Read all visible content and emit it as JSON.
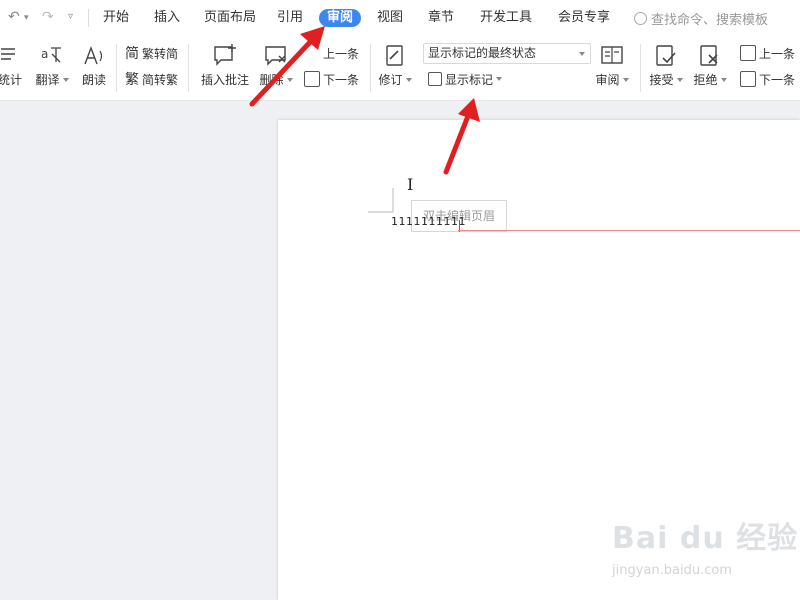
{
  "quick_access": {
    "undo_icon": "undo-icon",
    "redo_icon": "redo-icon",
    "more_icon": "customize-icon"
  },
  "tabs": [
    {
      "label": "开始"
    },
    {
      "label": "插入"
    },
    {
      "label": "页面布局"
    },
    {
      "label": "引用"
    },
    {
      "label": "审阅",
      "active": true
    },
    {
      "label": "视图"
    },
    {
      "label": "章节"
    },
    {
      "label": "开发工具"
    },
    {
      "label": "会员专享"
    }
  ],
  "search": {
    "placeholder": "查找命令、搜索模板"
  },
  "ribbon": {
    "word_count": "统计",
    "translate": "翻译",
    "read_aloud": "朗读",
    "trad_to_simp": "繁转简",
    "simp_to_trad": "简转繁",
    "insert_comment": "插入批注",
    "delete_comment": "删除",
    "prev_comment": "上一条",
    "next_comment": "下一条",
    "track_changes": "修订",
    "markup_state": "显示标记的最终状态",
    "show_markup": "显示标记",
    "review_pane": "审阅",
    "accept": "接受",
    "reject": "拒绝",
    "prev_change": "上一条",
    "next_change": "下一条"
  },
  "document": {
    "header_tooltip": "双击编辑页眉",
    "body_text": "1111111111"
  },
  "watermark": {
    "brand": "Bai du 经验",
    "url": "jingyan.baidu.com"
  },
  "colors": {
    "accent": "#3d86f0",
    "arrow": "#e02020",
    "workspace": "#eef0f3"
  }
}
